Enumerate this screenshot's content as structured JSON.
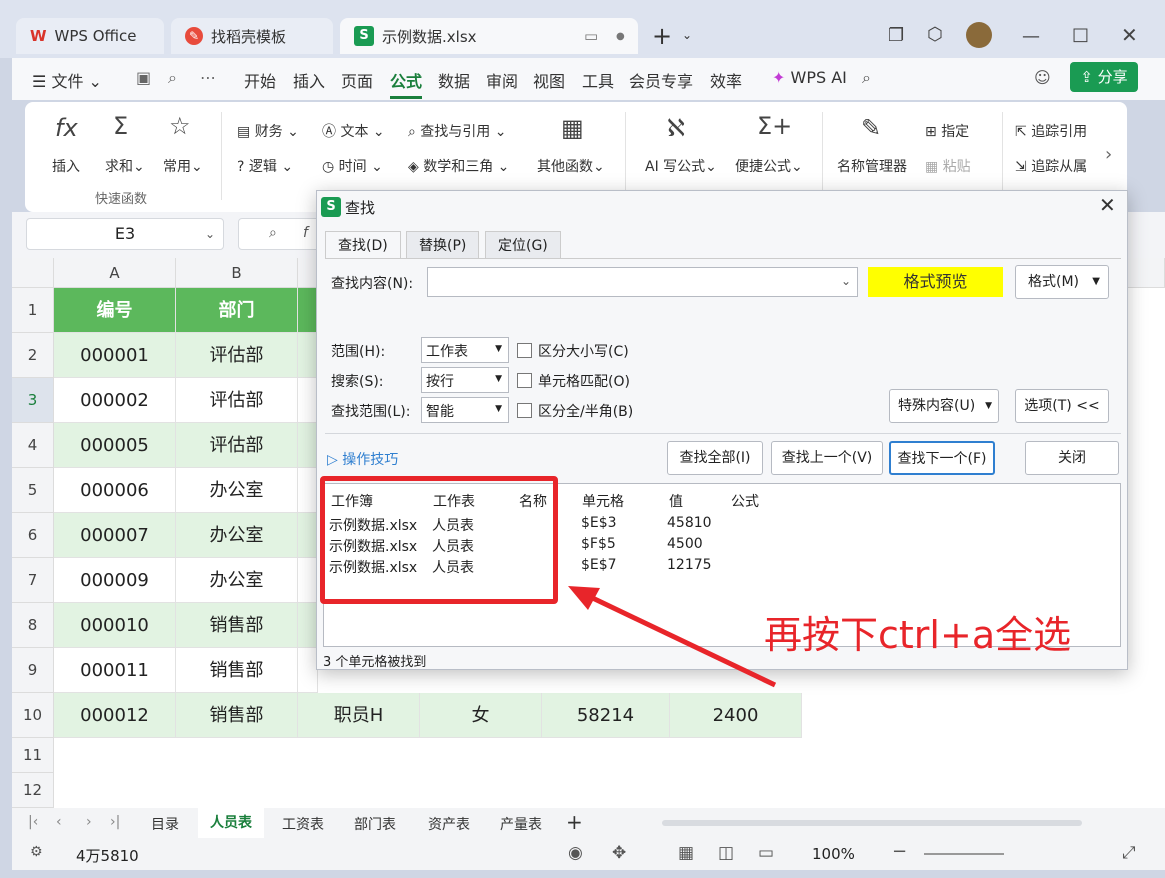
{
  "window": {
    "tabs": [
      {
        "label": "WPS Office"
      },
      {
        "label": "找稻壳模板"
      },
      {
        "label": "示例数据.xlsx"
      }
    ]
  },
  "menu": {
    "file": "文件",
    "items": [
      "开始",
      "插入",
      "页面",
      "公式",
      "数据",
      "审阅",
      "视图",
      "工具",
      "会员专享",
      "效率"
    ],
    "active": "公式",
    "wps_ai": "WPS AI",
    "share": "分享"
  },
  "ribbon": {
    "insert": "插入",
    "sum": "求和",
    "common": "常用",
    "quick_group": "快速函数",
    "finance": "财务",
    "text": "文本",
    "lookup": "查找与引用",
    "logic": "逻辑",
    "time": "时间",
    "math": "数学和三角",
    "other": "其他函数",
    "ai_write": "AI 写公式",
    "convenient": "便捷公式",
    "name_mgr": "名称管理器",
    "assign": "指定",
    "paste": "粘贴",
    "trace_prec": "追踪引用",
    "trace_dep": "追踪从属"
  },
  "formula_bar": {
    "cell_ref": "E3"
  },
  "sheet": {
    "columns": [
      "A",
      "B"
    ],
    "header_row": [
      "编号",
      "部门"
    ],
    "rows": [
      {
        "num": "2",
        "id": "000001",
        "dept": "评估部"
      },
      {
        "num": "3",
        "id": "000002",
        "dept": "评估部"
      },
      {
        "num": "4",
        "id": "000005",
        "dept": "评估部"
      },
      {
        "num": "5",
        "id": "000006",
        "dept": "办公室"
      },
      {
        "num": "6",
        "id": "000007",
        "dept": "办公室"
      },
      {
        "num": "7",
        "id": "000009",
        "dept": "办公室"
      },
      {
        "num": "8",
        "id": "000010",
        "dept": "销售部"
      },
      {
        "num": "9",
        "id": "000011",
        "dept": "销售部"
      },
      {
        "num": "10",
        "id": "000012",
        "dept": "销售部"
      }
    ],
    "row10_extra": [
      "职员H",
      "女",
      "58214",
      "2400"
    ],
    "empty_rows": [
      "11",
      "12"
    ]
  },
  "sheet_tabs": [
    "目录",
    "人员表",
    "工资表",
    "部门表",
    "资产表",
    "产量表"
  ],
  "active_sheet": "人员表",
  "status": {
    "sum_text": "4万5810",
    "zoom": "100%"
  },
  "dialog": {
    "title": "查找",
    "tabs": [
      "查找(D)",
      "替换(P)",
      "定位(G)"
    ],
    "find_label": "查找内容(N):",
    "format_preview": "格式预览",
    "format_btn": "格式(M)",
    "scope_label": "范围(H):",
    "scope_value": "工作表",
    "search_label": "搜索(S):",
    "search_value": "按行",
    "lookin_label": "查找范围(L):",
    "lookin_value": "智能",
    "opt_case": "区分大小写(C)",
    "opt_cell": "单元格匹配(O)",
    "opt_width": "区分全/半角(B)",
    "special_btn": "特殊内容(U)",
    "options_btn": "选项(T) <<",
    "tips": "操作技巧",
    "find_all": "查找全部(I)",
    "find_prev": "查找上一个(V)",
    "find_next": "查找下一个(F)",
    "close": "关闭",
    "result_headers": [
      "工作簿",
      "工作表",
      "名称",
      "单元格",
      "值",
      "公式"
    ],
    "results": [
      {
        "book": "示例数据.xlsx",
        "sheet": "人员表",
        "cell": "$E$3",
        "value": "45810"
      },
      {
        "book": "示例数据.xlsx",
        "sheet": "人员表",
        "cell": "$F$5",
        "value": "4500"
      },
      {
        "book": "示例数据.xlsx",
        "sheet": "人员表",
        "cell": "$E$7",
        "value": "12175"
      }
    ],
    "found_count": "3 个单元格被找到"
  },
  "annotation": {
    "text": "再按下ctrl+a全选",
    "color": "#e8252a"
  },
  "colors": {
    "header_green": "#5cb85c",
    "row_green": "#e2f3e2",
    "accent": "#1a7f3c"
  }
}
